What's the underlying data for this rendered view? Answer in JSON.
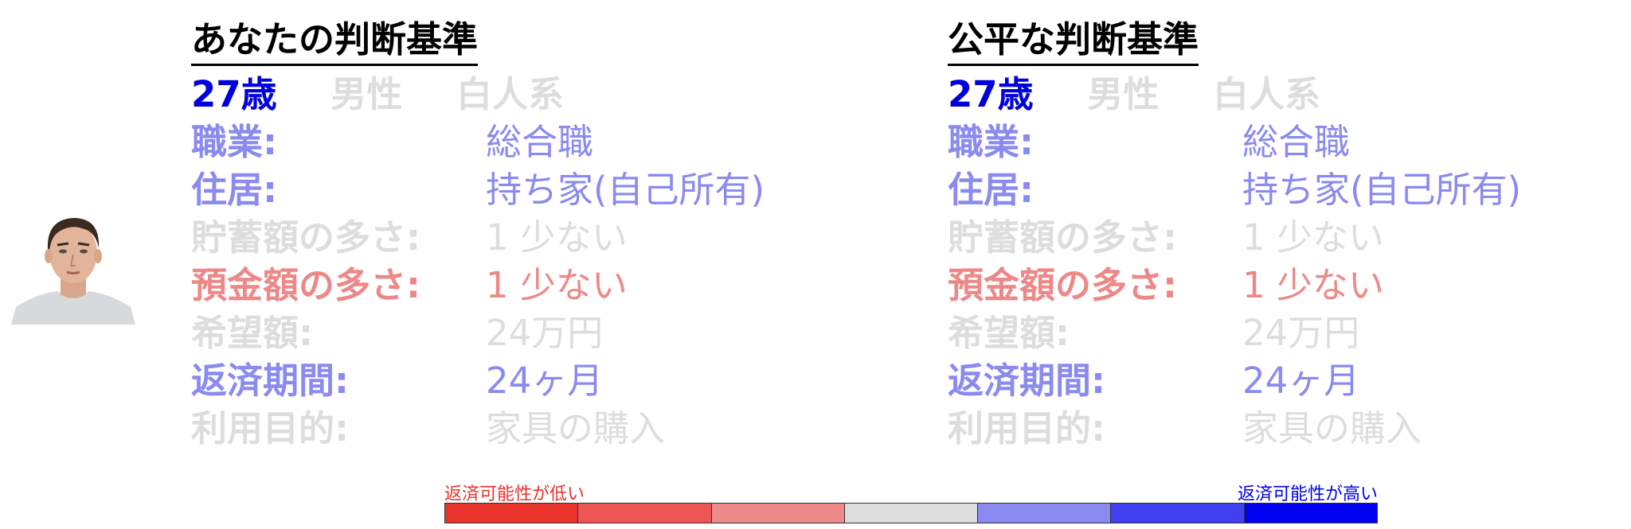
{
  "colors": {
    "strong_blue": "#0000dd",
    "light_blue": "#8a8af0",
    "light_red": "#ee8888",
    "faded": "#dddddd"
  },
  "left_panel": {
    "title": "あなたの判断基準",
    "demographics": {
      "age": "27歳",
      "gender": "男性",
      "ethnicity": "白人系"
    },
    "rows": [
      {
        "label": "職業:",
        "value": "総合職",
        "color": "#8a8af0"
      },
      {
        "label": "住居:",
        "value": "持ち家(自己所有)",
        "color": "#8a8af0"
      },
      {
        "label": "貯蓄額の多さ:",
        "value": "1 少ない",
        "color": "#dddddd"
      },
      {
        "label": "預金額の多さ:",
        "value": "1 少ない",
        "color": "#ee8888"
      },
      {
        "label": "希望額:",
        "value": "24万円",
        "color": "#dddddd"
      },
      {
        "label": "返済期間:",
        "value": "24ヶ月",
        "color": "#8a8af0"
      },
      {
        "label": "利用目的:",
        "value": "家具の購入",
        "color": "#dddddd"
      }
    ]
  },
  "right_panel": {
    "title": "公平な判断基準",
    "demographics": {
      "age": "27歳",
      "gender": "男性",
      "ethnicity": "白人系"
    },
    "rows": [
      {
        "label": "職業:",
        "value": "総合職",
        "color": "#8a8af0"
      },
      {
        "label": "住居:",
        "value": "持ち家(自己所有)",
        "color": "#8a8af0"
      },
      {
        "label": "貯蓄額の多さ:",
        "value": "1 少ない",
        "color": "#dddddd"
      },
      {
        "label": "預金額の多さ:",
        "value": "1 少ない",
        "color": "#ee8888"
      },
      {
        "label": "希望額:",
        "value": "24万円",
        "color": "#dddddd"
      },
      {
        "label": "返済期間:",
        "value": "24ヶ月",
        "color": "#8a8af0"
      },
      {
        "label": "利用目的:",
        "value": "家具の購入",
        "color": "#dddddd"
      }
    ]
  },
  "scale": {
    "low_label": "返済可能性が低い",
    "high_label": "返済可能性が高い",
    "segments": [
      "#e8322a",
      "#ee5656",
      "#ee8a8a",
      "#dddddd",
      "#8a8af0",
      "#4040f0",
      "#0000f0"
    ]
  },
  "avatar": {
    "icon": "person-portrait"
  }
}
